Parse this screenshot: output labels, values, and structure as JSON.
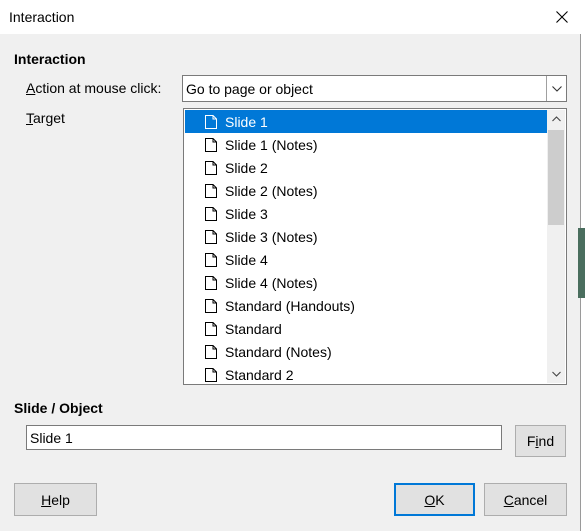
{
  "window": {
    "title": "Interaction"
  },
  "interaction_section": {
    "heading": "Interaction"
  },
  "action": {
    "label_underlined": "A",
    "label_rest": "ction at mouse click:",
    "value": "Go to page or object"
  },
  "target": {
    "label_underlined": "T",
    "label_rest": "arget",
    "items": [
      "Slide 1",
      "Slide 1 (Notes)",
      "Slide 2",
      "Slide 2 (Notes)",
      "Slide 3",
      "Slide 3 (Notes)",
      "Slide 4",
      "Slide 4 (Notes)",
      "Standard (Handouts)",
      "Standard",
      "Standard (Notes)",
      "Standard 2"
    ],
    "selected": "Slide 1"
  },
  "slide_object": {
    "heading": "Slide / Object",
    "value": "Slide 1"
  },
  "buttons": {
    "find_pre": "F",
    "find_u": "i",
    "find_post": "nd",
    "help_u": "H",
    "help_rest": "elp",
    "ok_u": "O",
    "ok_rest": "K",
    "cancel_u": "C",
    "cancel_rest": "ancel"
  },
  "colors": {
    "selection": "#0078d7",
    "dialog_bg": "#f0f0f0"
  },
  "icons": [
    "close-icon",
    "chevron-down-icon",
    "chevron-up-icon",
    "document-icon"
  ]
}
